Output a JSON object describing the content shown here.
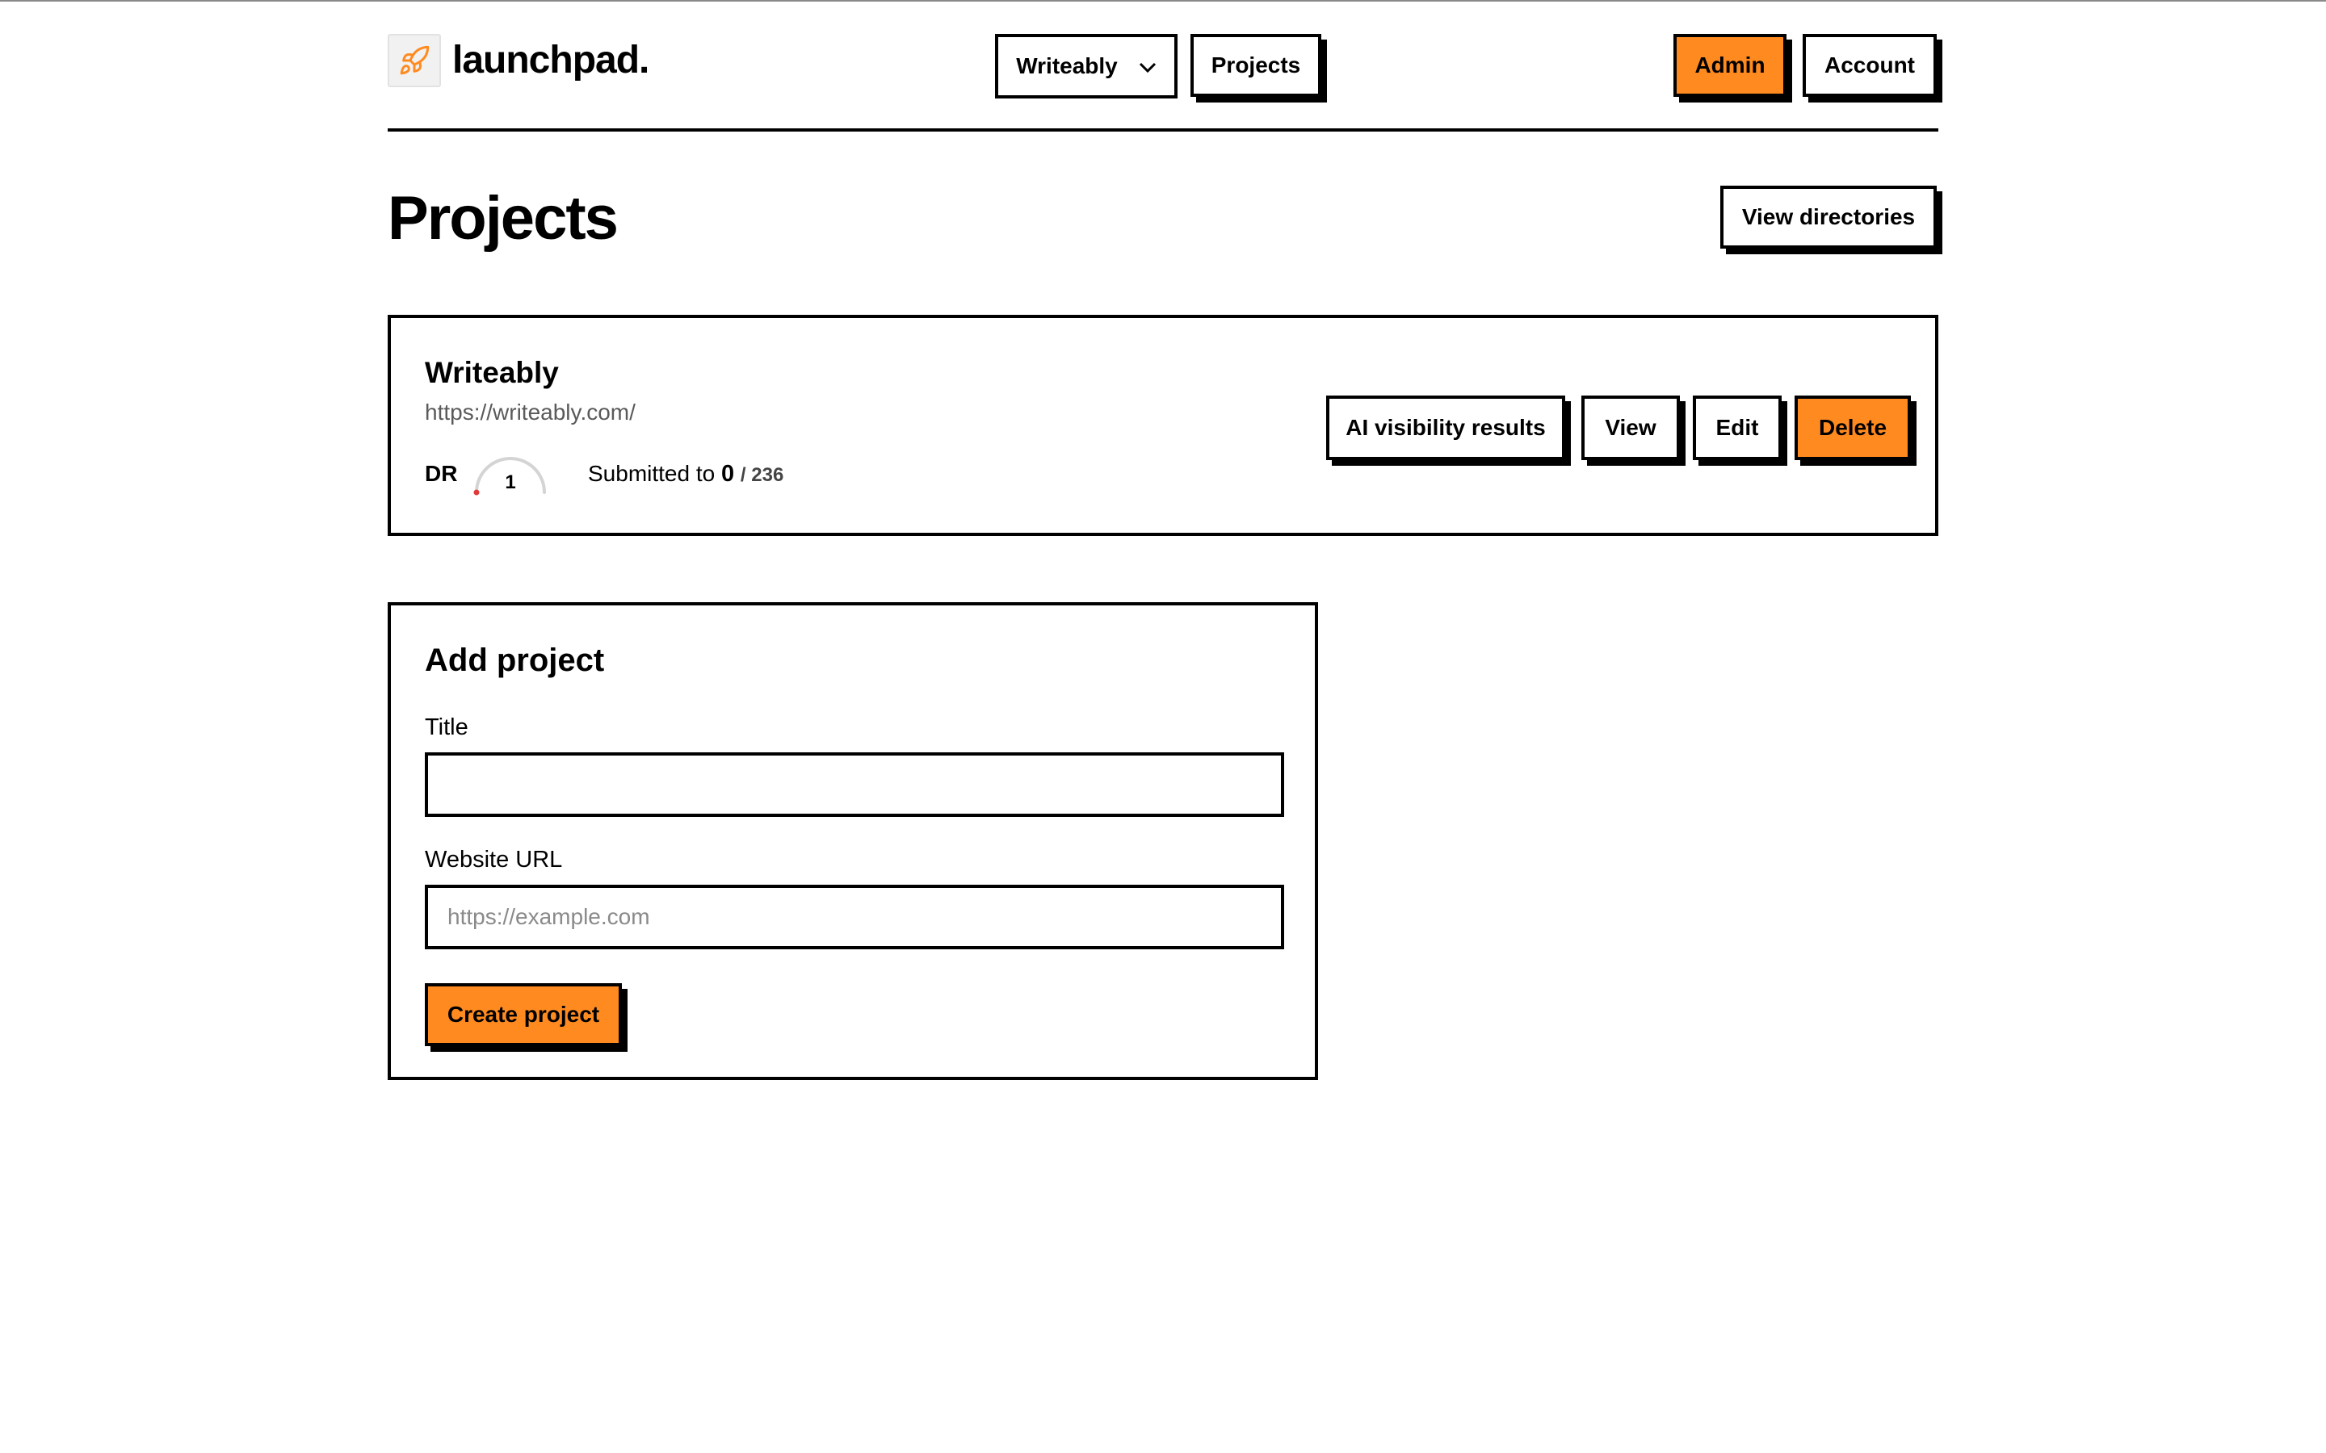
{
  "brand": {
    "name": "launchpad."
  },
  "header": {
    "project_selector": "Writeably",
    "projects_label": "Projects",
    "admin_label": "Admin",
    "account_label": "Account"
  },
  "page": {
    "title": "Projects",
    "view_directories_label": "View directories"
  },
  "project": {
    "name": "Writeably",
    "url": "https://writeably.com/",
    "dr_label": "DR",
    "dr_value": "1",
    "submitted_label": "Submitted to",
    "submitted_count": "0",
    "submitted_total": "/ 236",
    "actions": {
      "ai_visibility": "AI visibility results",
      "view": "View",
      "edit": "Edit",
      "delete": "Delete"
    }
  },
  "add_project": {
    "title": "Add project",
    "title_label": "Title",
    "title_value": "",
    "url_label": "Website URL",
    "url_placeholder": "https://example.com",
    "submit_label": "Create project"
  },
  "colors": {
    "accent": "#ff8a1f",
    "border": "#000000",
    "muted": "#5a5a5a"
  }
}
